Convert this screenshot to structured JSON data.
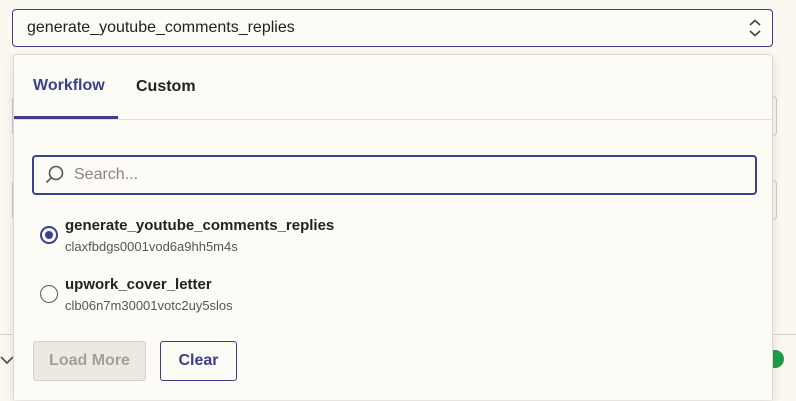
{
  "select": {
    "value": "generate_youtube_comments_replies",
    "icon": "chevron-up-down-icon"
  },
  "tabs": [
    {
      "label": "Workflow",
      "active": true
    },
    {
      "label": "Custom",
      "active": false
    }
  ],
  "search": {
    "placeholder": "Search...",
    "value": "",
    "icon": "search-icon"
  },
  "options": [
    {
      "title": "generate_youtube_comments_replies",
      "id": "claxfbdgs0001vod6a9hh5m4s",
      "selected": true
    },
    {
      "title": "upwork_cover_letter",
      "id": "clb06n7m30001votc2uy5slos",
      "selected": false
    }
  ],
  "buttons": {
    "load_more": "Load More",
    "clear": "Clear"
  },
  "colors": {
    "accent": "#3b3f8c",
    "background": "#fbf8f1",
    "status_green": "#1e9e4b"
  }
}
